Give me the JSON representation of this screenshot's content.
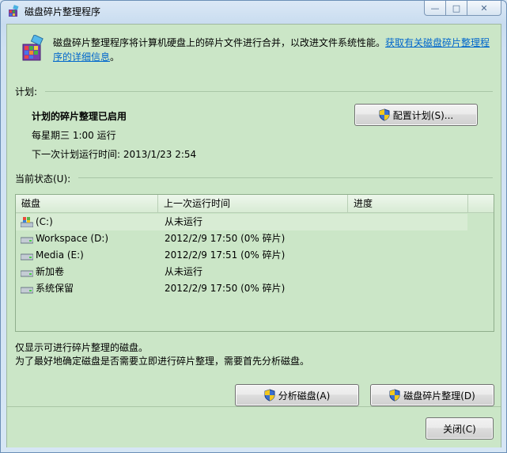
{
  "window": {
    "title": "磁盘碎片整理程序",
    "caption_buttons": [
      "minimize",
      "maximize",
      "close"
    ]
  },
  "intro": {
    "text": "磁盘碎片整理程序将计算机硬盘上的碎片文件进行合并，以改进文件系统性能。",
    "link": "获取有关磁盘碎片整理程序的详细信息",
    "suffix": "。"
  },
  "schedule": {
    "group_label": "计划:",
    "status": "计划的碎片整理已启用",
    "when": "每星期三  1:00 运行",
    "next_run": "下一次计划运行时间: 2013/1/23 2:54",
    "configure_button": "配置计划(S)..."
  },
  "current_status": {
    "group_label": "当前状态(U):",
    "columns": [
      "磁盘",
      "上一次运行时间",
      "进度"
    ],
    "rows": [
      {
        "disk": "(C:)",
        "last_run": "从未运行",
        "progress": "",
        "icon": "system-drive-icon"
      },
      {
        "disk": "Workspace (D:)",
        "last_run": "2012/2/9 17:50 (0% 碎片)",
        "progress": "",
        "icon": "drive-icon"
      },
      {
        "disk": "Media (E:)",
        "last_run": "2012/2/9 17:51 (0% 碎片)",
        "progress": "",
        "icon": "drive-icon"
      },
      {
        "disk": "新加卷",
        "last_run": "从未运行",
        "progress": "",
        "icon": "drive-icon"
      },
      {
        "disk": "系统保留",
        "last_run": "2012/2/9 17:50 (0% 碎片)",
        "progress": "",
        "icon": "drive-icon"
      }
    ]
  },
  "notes": {
    "line1": "仅显示可进行碎片整理的磁盘。",
    "line2": "为了最好地确定磁盘是否需要立即进行碎片整理，需要首先分析磁盘。"
  },
  "actions": {
    "analyze": "分析磁盘(A)",
    "defrag": "磁盘碎片整理(D)",
    "close": "关闭(C)"
  }
}
